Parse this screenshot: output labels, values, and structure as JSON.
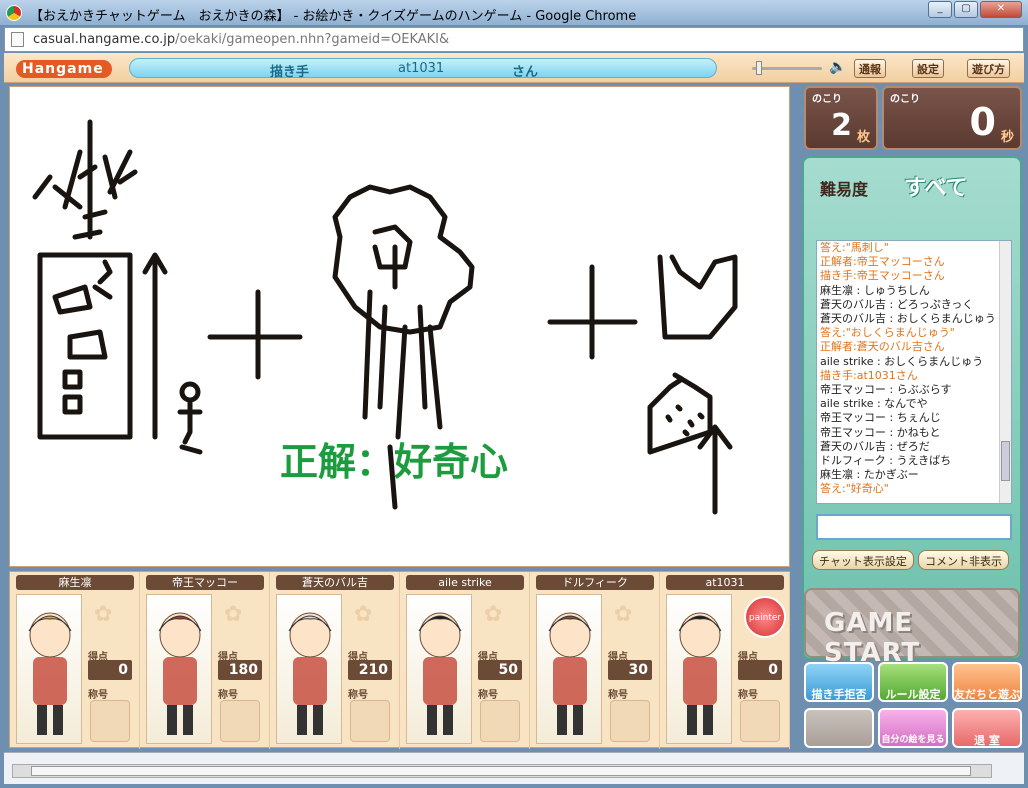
{
  "window": {
    "title": "【おえかきチャットゲーム　おえかきの森】 - お絵かき・クイズゲームのハンゲーム - Google Chrome",
    "url_host": "casual.hangame.co.jp",
    "url_path": "/oekaki/gameopen.nhn?gameid=OEKAKI&"
  },
  "header": {
    "logo": "Hangame",
    "role_label": "描き手",
    "drawer_name": "at1031",
    "honorific": "さん",
    "buttons": [
      "通報",
      "設定",
      "遊び方"
    ]
  },
  "canvas": {
    "answer_text": "正解：好奇心"
  },
  "counters": {
    "cards_label": "のこり",
    "cards_value": "2",
    "cards_unit": "枚",
    "time_label": "のこり",
    "time_value": "0",
    "time_unit": "秒"
  },
  "chat": {
    "difficulty_label": "難易度",
    "difficulty_value": "すべて",
    "messages": [
      {
        "text": "答え:\"馬刺し\"",
        "color": "orange"
      },
      {
        "text": "正解者:帝王マッコーさん",
        "color": "orange"
      },
      {
        "text": "描き手:帝王マッコーさん",
        "color": "orange"
      },
      {
        "text": "麻生凛 : しゅうちしん",
        "color": "black"
      },
      {
        "text": "蒼天のバル吉 : どろっぷきっく",
        "color": "black"
      },
      {
        "text": "蒼天のバル吉 : おしくらまんじゅう",
        "color": "black"
      },
      {
        "text": "答え:\"おしくらまんじゅう\"",
        "color": "orange"
      },
      {
        "text": "正解者:蒼天のバル吉さん",
        "color": "orange"
      },
      {
        "text": "aile strike : おしくらまんじゅう",
        "color": "black"
      },
      {
        "text": "描き手:at1031さん",
        "color": "orange"
      },
      {
        "text": "帝王マッコー : らぶぶらす",
        "color": "black"
      },
      {
        "text": "aile strike : なんでや",
        "color": "black"
      },
      {
        "text": "帝王マッコー : ちぇんじ",
        "color": "black"
      },
      {
        "text": "帝王マッコー : かねもと",
        "color": "black"
      },
      {
        "text": "蒼天のバル吉 : ぜろだ",
        "color": "black"
      },
      {
        "text": "ドルフィーク : うえきばち",
        "color": "black"
      },
      {
        "text": "麻生凛 : たかぎぶー",
        "color": "black"
      },
      {
        "text": "答え:\"好奇心\"",
        "color": "orange"
      }
    ],
    "input_value": "",
    "btn_chat_settings": "チャット表示設定",
    "btn_hide_comments": "コメント非表示"
  },
  "controls": {
    "game_start": "GAME START",
    "reject_drawer": "描き手拒否",
    "rule_settings": "ルール設定",
    "play_with_friends": "友だちと遊ぶ",
    "view_my_drawings": "自分の絵を見る",
    "leave_room": "退 室"
  },
  "players": [
    {
      "name": "麻生凛",
      "score_label": "得点",
      "score": "0",
      "title_label": "称号",
      "hair": "#e3b13a"
    },
    {
      "name": "帝王マッコー",
      "score_label": "得点",
      "score": "180",
      "title_label": "称号",
      "hair": "#c0392b"
    },
    {
      "name": "蒼天のバル吉",
      "score_label": "得点",
      "score": "210",
      "title_label": "称号",
      "hair": "#dcdcdc"
    },
    {
      "name": "aile strike",
      "score_label": "得点",
      "score": "50",
      "title_label": "称号",
      "hair": "#1d1d1d"
    },
    {
      "name": "ドルフィーク",
      "score_label": "得点",
      "score": "30",
      "title_label": "称号",
      "hair": "#8a5a2b"
    },
    {
      "name": "at1031",
      "score_label": "得点",
      "score": "0",
      "title_label": "称号",
      "hair": "#1d1d1d",
      "painter_badge": "painter"
    }
  ]
}
